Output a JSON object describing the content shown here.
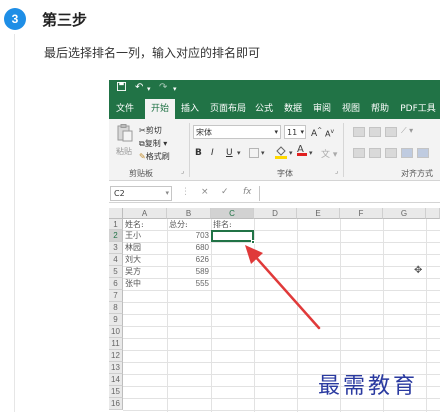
{
  "step": {
    "number": "3",
    "title": "第三步",
    "description": "最后选择排名一列，输入对应的排名即可"
  },
  "excel": {
    "quick_access": {
      "save_icon": "save-icon",
      "undo_icon": "undo-icon",
      "redo_icon": "redo-icon"
    },
    "tabs": [
      "文件",
      "开始",
      "插入",
      "页面布局",
      "公式",
      "数据",
      "审阅",
      "视图",
      "帮助",
      "PDF工具"
    ],
    "active_tab": "开始",
    "ribbon": {
      "paste": "粘贴",
      "cut": "剪切",
      "copy": "复制",
      "format_painter": "格式刷",
      "clipboard_label": "剪贴板",
      "font_name": "宋体",
      "font_size": "11",
      "grow": "A",
      "shrink": "A",
      "bold": "B",
      "italic": "I",
      "underline": "U",
      "font_label": "字体",
      "wen": "文",
      "align_label": "对齐方式"
    },
    "formula_bar": {
      "name_box": "C2",
      "cancel": "×",
      "enter": "✓",
      "fx": "fx",
      "value": ""
    },
    "columns": [
      "A",
      "B",
      "C",
      "D",
      "E",
      "F",
      "G"
    ],
    "selected_column": "C",
    "rows": [
      "1",
      "2",
      "3",
      "4",
      "5",
      "6",
      "7",
      "8",
      "9",
      "10",
      "11",
      "12",
      "13",
      "14",
      "15",
      "16"
    ],
    "selected_row": "2",
    "headers": {
      "name": "姓名:",
      "score": "总分:",
      "rank": "排名:"
    },
    "data_rows": [
      {
        "name": "王小",
        "score": "703"
      },
      {
        "name": "林园",
        "score": "680"
      },
      {
        "name": "刘大",
        "score": "626"
      },
      {
        "name": "吴方",
        "score": "589"
      },
      {
        "name": "张中",
        "score": "555"
      }
    ],
    "arrow_color": "#e03a3a",
    "accent_color": "#217346"
  },
  "watermark": "最需教育"
}
